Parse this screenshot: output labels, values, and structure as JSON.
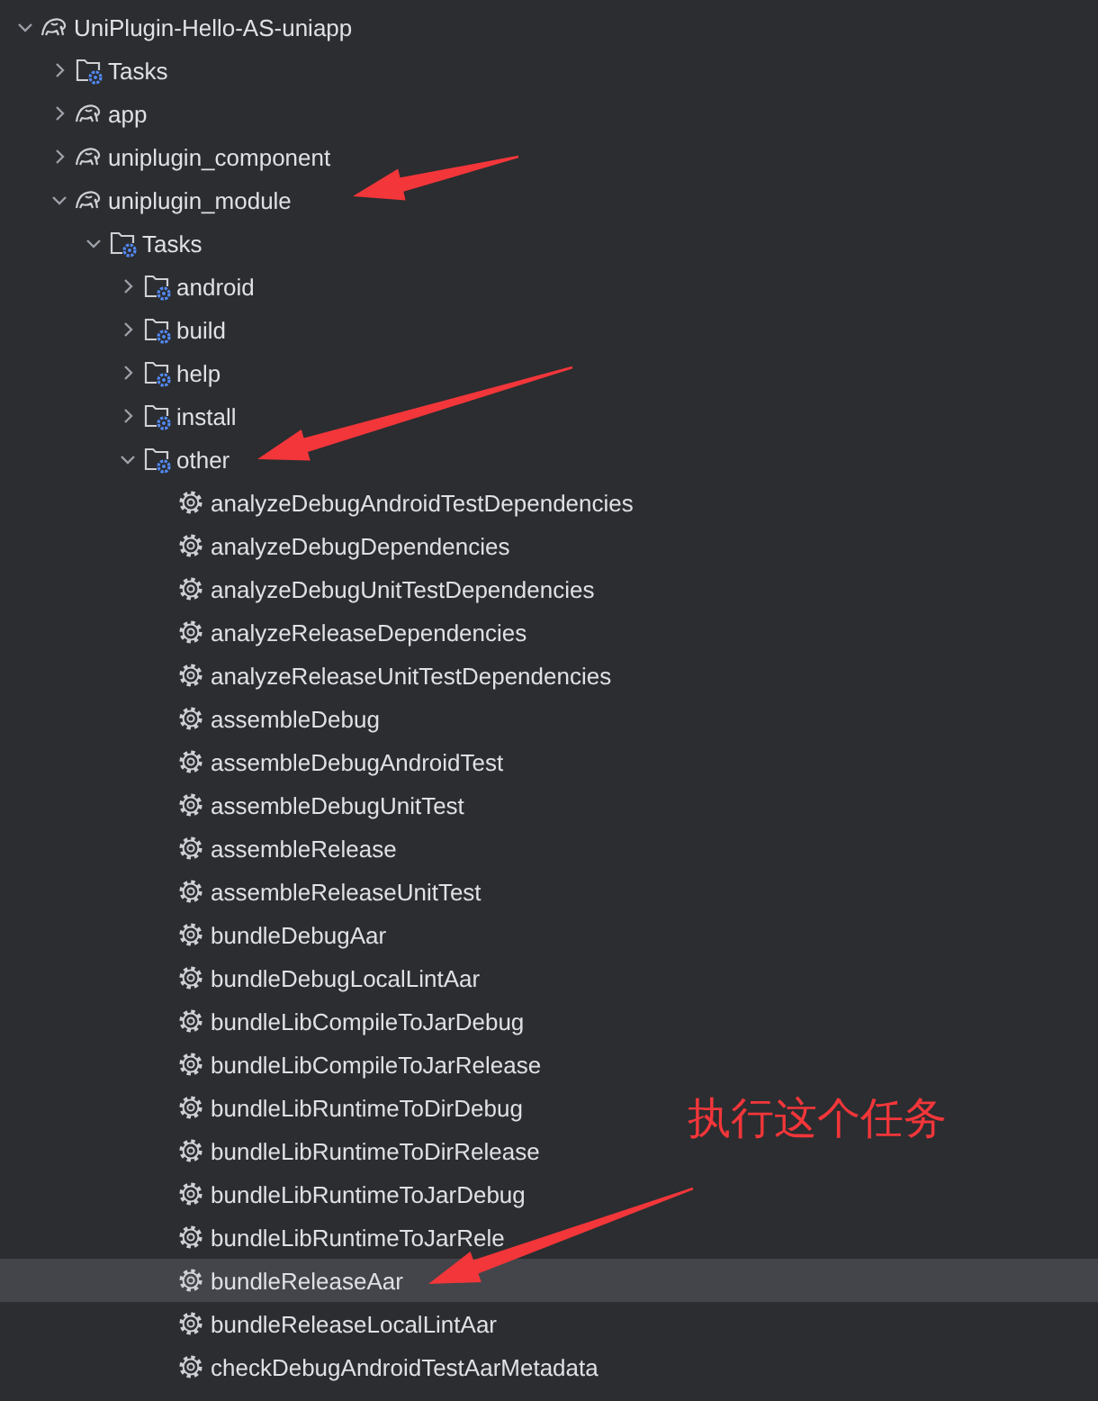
{
  "tree": [
    {
      "label": "UniPlugin-Hello-AS-uniapp",
      "kind": "project",
      "expanded": true,
      "selected": false,
      "children": [
        {
          "label": "Tasks",
          "kind": "folder",
          "expanded": false,
          "selected": false
        },
        {
          "label": "app",
          "kind": "project",
          "expanded": false,
          "selected": false
        },
        {
          "label": "uniplugin_component",
          "kind": "project",
          "expanded": false,
          "selected": false
        },
        {
          "label": "uniplugin_module",
          "kind": "project",
          "expanded": true,
          "selected": false,
          "children": [
            {
              "label": "Tasks",
              "kind": "folder",
              "expanded": true,
              "selected": false,
              "children": [
                {
                  "label": "android",
                  "kind": "folder",
                  "expanded": false,
                  "selected": false
                },
                {
                  "label": "build",
                  "kind": "folder",
                  "expanded": false,
                  "selected": false
                },
                {
                  "label": "help",
                  "kind": "folder",
                  "expanded": false,
                  "selected": false
                },
                {
                  "label": "install",
                  "kind": "folder",
                  "expanded": false,
                  "selected": false
                },
                {
                  "label": "other",
                  "kind": "folder",
                  "expanded": true,
                  "selected": false,
                  "children": [
                    {
                      "label": "analyzeDebugAndroidTestDependencies",
                      "kind": "task",
                      "selected": false
                    },
                    {
                      "label": "analyzeDebugDependencies",
                      "kind": "task",
                      "selected": false
                    },
                    {
                      "label": "analyzeDebugUnitTestDependencies",
                      "kind": "task",
                      "selected": false
                    },
                    {
                      "label": "analyzeReleaseDependencies",
                      "kind": "task",
                      "selected": false
                    },
                    {
                      "label": "analyzeReleaseUnitTestDependencies",
                      "kind": "task",
                      "selected": false
                    },
                    {
                      "label": "assembleDebug",
                      "kind": "task",
                      "selected": false
                    },
                    {
                      "label": "assembleDebugAndroidTest",
                      "kind": "task",
                      "selected": false
                    },
                    {
                      "label": "assembleDebugUnitTest",
                      "kind": "task",
                      "selected": false
                    },
                    {
                      "label": "assembleRelease",
                      "kind": "task",
                      "selected": false
                    },
                    {
                      "label": "assembleReleaseUnitTest",
                      "kind": "task",
                      "selected": false
                    },
                    {
                      "label": "bundleDebugAar",
                      "kind": "task",
                      "selected": false
                    },
                    {
                      "label": "bundleDebugLocalLintAar",
                      "kind": "task",
                      "selected": false
                    },
                    {
                      "label": "bundleLibCompileToJarDebug",
                      "kind": "task",
                      "selected": false
                    },
                    {
                      "label": "bundleLibCompileToJarRelease",
                      "kind": "task",
                      "selected": false
                    },
                    {
                      "label": "bundleLibRuntimeToDirDebug",
                      "kind": "task",
                      "selected": false
                    },
                    {
                      "label": "bundleLibRuntimeToDirRelease",
                      "kind": "task",
                      "selected": false
                    },
                    {
                      "label": "bundleLibRuntimeToJarDebug",
                      "kind": "task",
                      "selected": false
                    },
                    {
                      "label": "bundleLibRuntimeToJarRele",
                      "kind": "task",
                      "selected": false
                    },
                    {
                      "label": "bundleReleaseAar",
                      "kind": "task",
                      "selected": true
                    },
                    {
                      "label": "bundleReleaseLocalLintAar",
                      "kind": "task",
                      "selected": false
                    },
                    {
                      "label": "checkDebugAndroidTestAarMetadata",
                      "kind": "task",
                      "selected": false
                    }
                  ]
                }
              ]
            }
          ]
        }
      ]
    }
  ],
  "annotation": {
    "note": "执行这个任务"
  }
}
